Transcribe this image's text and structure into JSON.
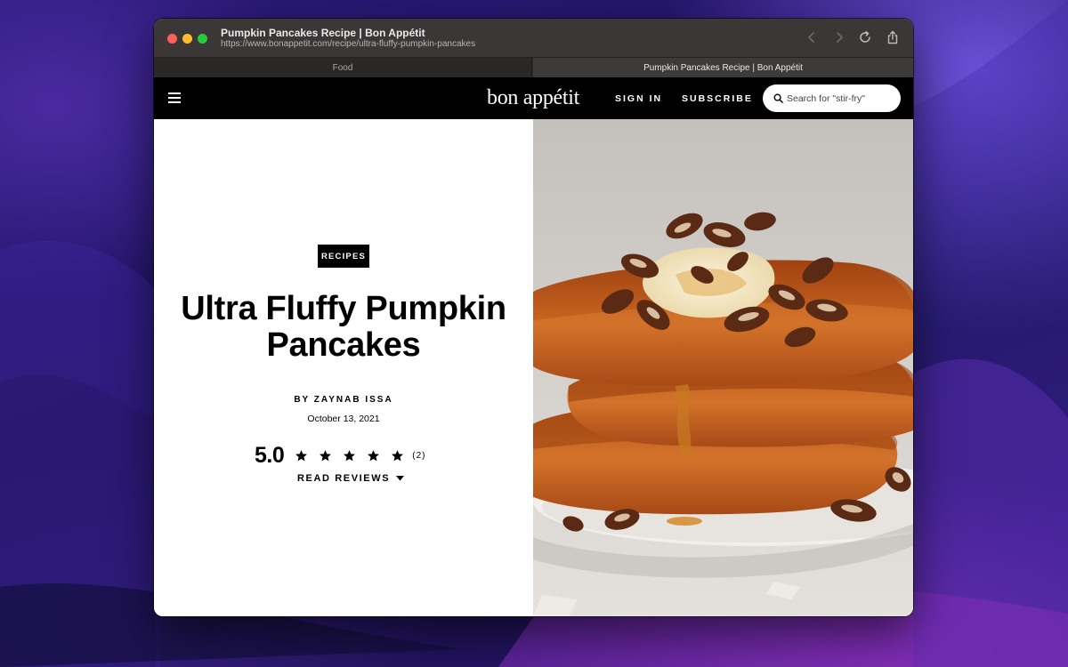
{
  "browser": {
    "page_title": "Pumpkin Pancakes Recipe | Bon Appétit",
    "url": "https://www.bonappetit.com/recipe/ultra-fluffy-pumpkin-pancakes",
    "tabs": [
      {
        "label": "Food",
        "active": false
      },
      {
        "label": "Pumpkin Pancakes Recipe | Bon Appétit",
        "active": true
      }
    ]
  },
  "header": {
    "logo": "bon appétit",
    "sign_in": "SIGN IN",
    "subscribe": "SUBSCRIBE",
    "search_placeholder": "Search for \"stir-fry\""
  },
  "article": {
    "rubric": "RECIPES",
    "title": "Ultra Fluffy Pumpkin Pancakes",
    "byline": "BY ZAYNAB ISSA",
    "date": "October 13, 2021",
    "rating": {
      "value": "5.0",
      "stars": 5,
      "max_stars": 5,
      "count": "(2)"
    },
    "read_reviews": "READ REVIEWS"
  },
  "colors": {
    "header_bg": "#000000",
    "window_titlebar": "#3a3736",
    "pancake": "#c8661f"
  },
  "icons": {
    "menu": "hamburger-menu-icon",
    "search": "search-icon",
    "star": "star-icon",
    "dropdown": "chevron-down-icon"
  }
}
